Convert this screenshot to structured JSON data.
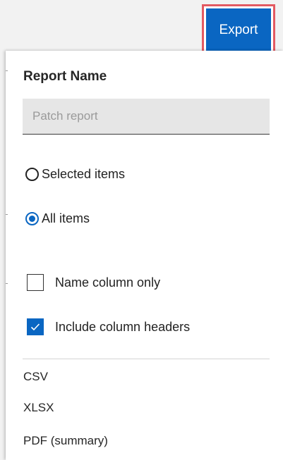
{
  "toolbar": {
    "export_label": "Export"
  },
  "export_panel": {
    "title": "Report Name",
    "report_name": {
      "value": "",
      "placeholder": "Patch report"
    },
    "scope_options": [
      {
        "label": "Selected items",
        "checked": false
      },
      {
        "label": "All items",
        "checked": true
      }
    ],
    "checkbox_options": [
      {
        "label": "Name column only",
        "checked": false
      },
      {
        "label": "Include column headers",
        "checked": true
      }
    ],
    "formats": [
      "CSV",
      "XLSX",
      "PDF (summary)"
    ]
  },
  "colors": {
    "accent": "#0a66c2",
    "highlight_border": "#e35a62"
  },
  "icons": {
    "radio_checked": "radio-checked-icon",
    "radio_unchecked": "radio-unchecked-icon",
    "checkbox_checked": "checkmark-icon"
  }
}
